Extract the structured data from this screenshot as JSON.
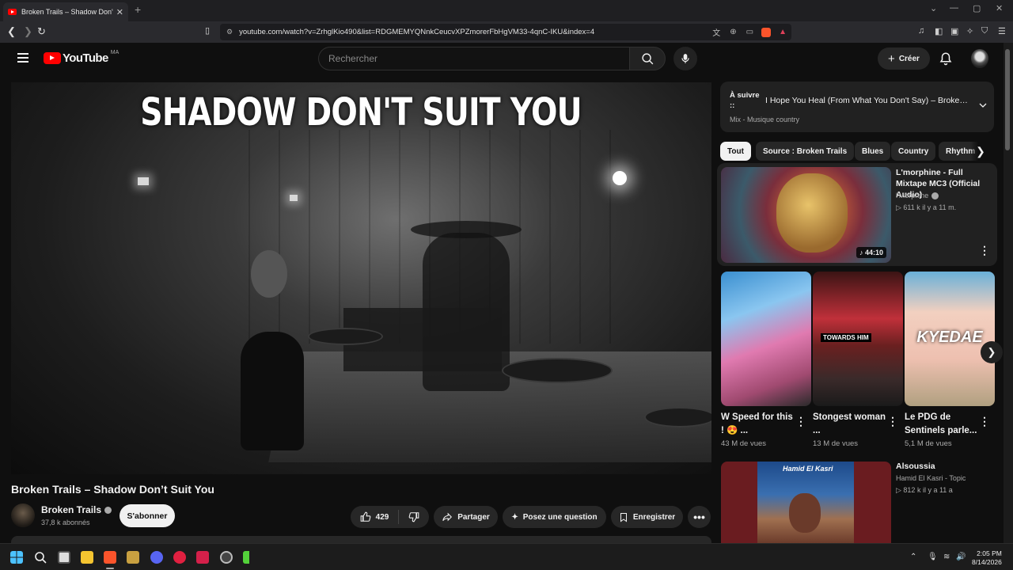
{
  "browser": {
    "tab_title": "Broken Trails – Shadow Don't Suit You",
    "url": "youtube.com/watch?v=ZrhglKio490&list=RDGMEMYQNnkCeucvXPZmorerFbHgVM33-4qnC-IKU&index=4"
  },
  "header": {
    "logo_text": "YouTube",
    "country_code": "MA",
    "search_placeholder": "Rechercher",
    "create_label": "Créer"
  },
  "player": {
    "overlay_title": "SHADOW DON'T SUIT YOU"
  },
  "video": {
    "title": "Broken Trails – Shadow Don’t Suit You",
    "channel_name": "Broken Trails",
    "subscribers": "37,8 k abonnés",
    "subscribe_label": "S'abonner",
    "likes": "429",
    "share_label": "Partager",
    "ask_label": "Posez une question",
    "save_label": "Enregistrer"
  },
  "up_next": {
    "label": "À suivre ::",
    "title": "I Hope You Heal (From What You Don't Say) – Broken Trails",
    "subtitle": "Mix - Musique country"
  },
  "chips": [
    "Tout",
    "Source : Broken Trails",
    "Blues",
    "Country",
    "Rhythm"
  ],
  "recommendations": {
    "mix": {
      "title": "L'morphine - Full Mixtape MC3 (Official Audio)",
      "channel": "l'Morphine",
      "meta": "▷ 611 k  il y a 11 m.",
      "duration": "44:10"
    },
    "shorts": [
      {
        "title": "W Speed for this ! 😍 ...",
        "views": "43 M de vues"
      },
      {
        "title": "Stongest woman ...",
        "views": "13 M de vues"
      },
      {
        "title": "Le PDG de Sentinels parle...",
        "views": "5,1 M de vues"
      }
    ],
    "short2_overlay": "TOWARDS HIM",
    "short3_overlay": "KYEDAE",
    "video4": {
      "title": "Alsoussia",
      "channel": "Hamid El Kasri - Topic",
      "meta": "▷ 812 k  il y a 11 a",
      "thumb_text": "Hamid El Kasri"
    }
  },
  "taskbar": {
    "time": "2:05 PM",
    "date": "8/14/2026"
  }
}
